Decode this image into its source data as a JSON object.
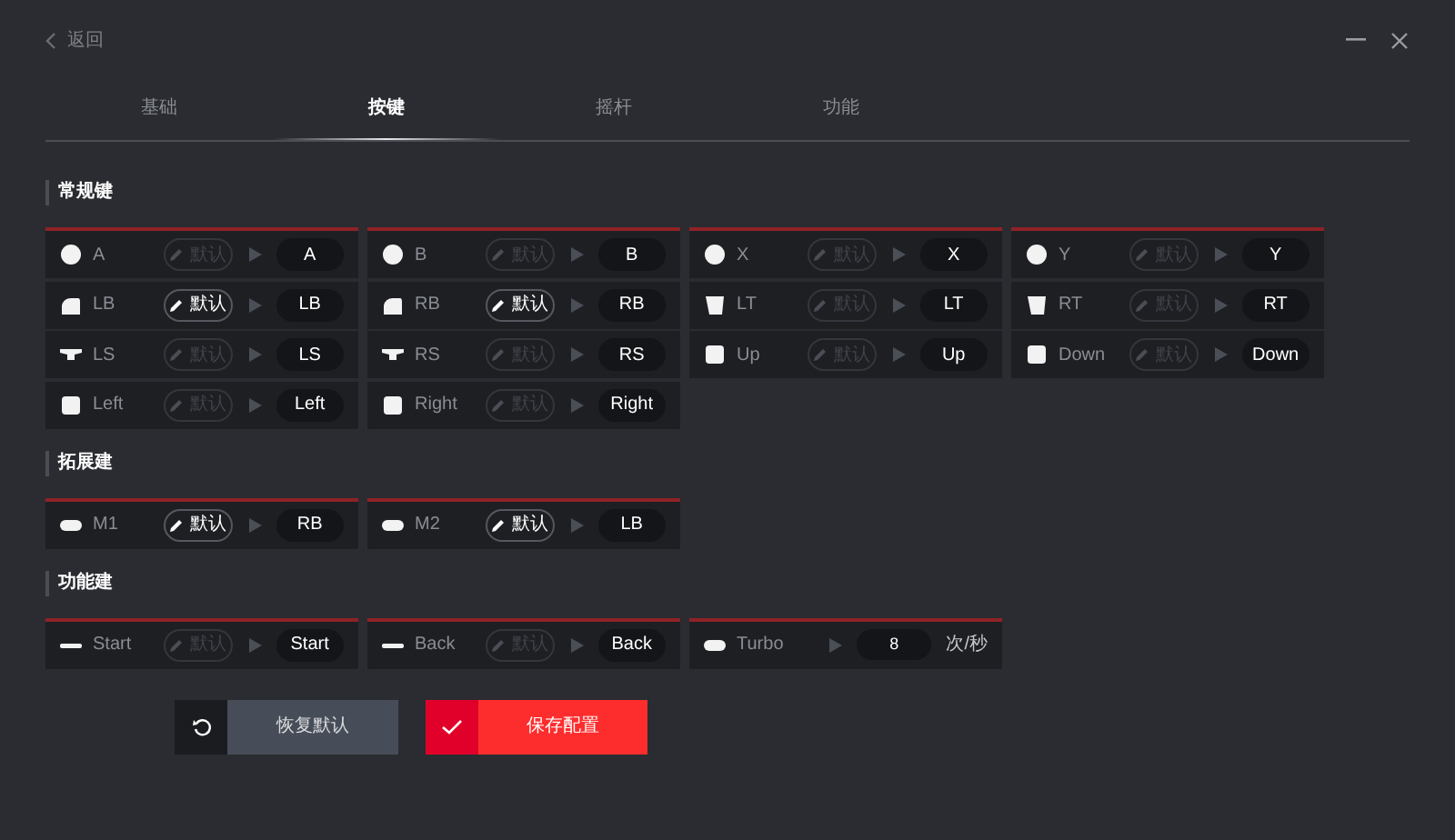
{
  "header": {
    "back": "返回"
  },
  "tabs": [
    {
      "label": "基础",
      "selected": false
    },
    {
      "label": "按键",
      "selected": true
    },
    {
      "label": "摇杆",
      "selected": false
    },
    {
      "label": "功能",
      "selected": false
    }
  ],
  "sections": [
    {
      "title": "常规键",
      "columns": [
        [
          {
            "kind": "circle",
            "name": "A",
            "default": "默认",
            "active": false,
            "mapping": "A"
          },
          {
            "kind": "bumper",
            "name": "LB",
            "default": "默认",
            "active": true,
            "mapping": "LB"
          },
          {
            "kind": "stick",
            "name": "LS",
            "default": "默认",
            "active": false,
            "mapping": "LS"
          },
          {
            "kind": "square",
            "name": "Left",
            "default": "默认",
            "active": false,
            "mapping": "Left"
          }
        ],
        [
          {
            "kind": "circle",
            "name": "B",
            "default": "默认",
            "active": false,
            "mapping": "B"
          },
          {
            "kind": "bumper",
            "name": "RB",
            "default": "默认",
            "active": true,
            "mapping": "RB"
          },
          {
            "kind": "stick",
            "name": "RS",
            "default": "默认",
            "active": false,
            "mapping": "RS"
          },
          {
            "kind": "square",
            "name": "Right",
            "default": "默认",
            "active": false,
            "mapping": "Right"
          }
        ],
        [
          {
            "kind": "circle",
            "name": "X",
            "default": "默认",
            "active": false,
            "mapping": "X"
          },
          {
            "kind": "trigger",
            "name": "LT",
            "default": "默认",
            "active": false,
            "mapping": "LT"
          },
          {
            "kind": "square",
            "name": "Up",
            "default": "默认",
            "active": false,
            "mapping": "Up"
          }
        ],
        [
          {
            "kind": "circle",
            "name": "Y",
            "default": "默认",
            "active": false,
            "mapping": "Y"
          },
          {
            "kind": "trigger",
            "name": "RT",
            "default": "默认",
            "active": false,
            "mapping": "RT"
          },
          {
            "kind": "square",
            "name": "Down",
            "default": "默认",
            "active": false,
            "mapping": "Down"
          }
        ]
      ]
    },
    {
      "title": "拓展建",
      "columns": [
        [
          {
            "kind": "pill",
            "name": "M1",
            "default": "默认",
            "active": true,
            "mapping": "RB"
          }
        ],
        [
          {
            "kind": "pill",
            "name": "M2",
            "default": "默认",
            "active": true,
            "mapping": "LB"
          }
        ]
      ]
    },
    {
      "title": "功能建",
      "columns": [
        [
          {
            "kind": "dash",
            "name": "Start",
            "default": "默认",
            "active": false,
            "mapping": "Start"
          }
        ],
        [
          {
            "kind": "dash",
            "name": "Back",
            "default": "默认",
            "active": false,
            "mapping": "Back"
          }
        ],
        [
          {
            "kind": "turbo",
            "name": "Turbo",
            "value": "8",
            "unit": "次/秒"
          }
        ]
      ]
    }
  ],
  "actions": {
    "restore": "恢复默认",
    "save": "保存配置"
  }
}
